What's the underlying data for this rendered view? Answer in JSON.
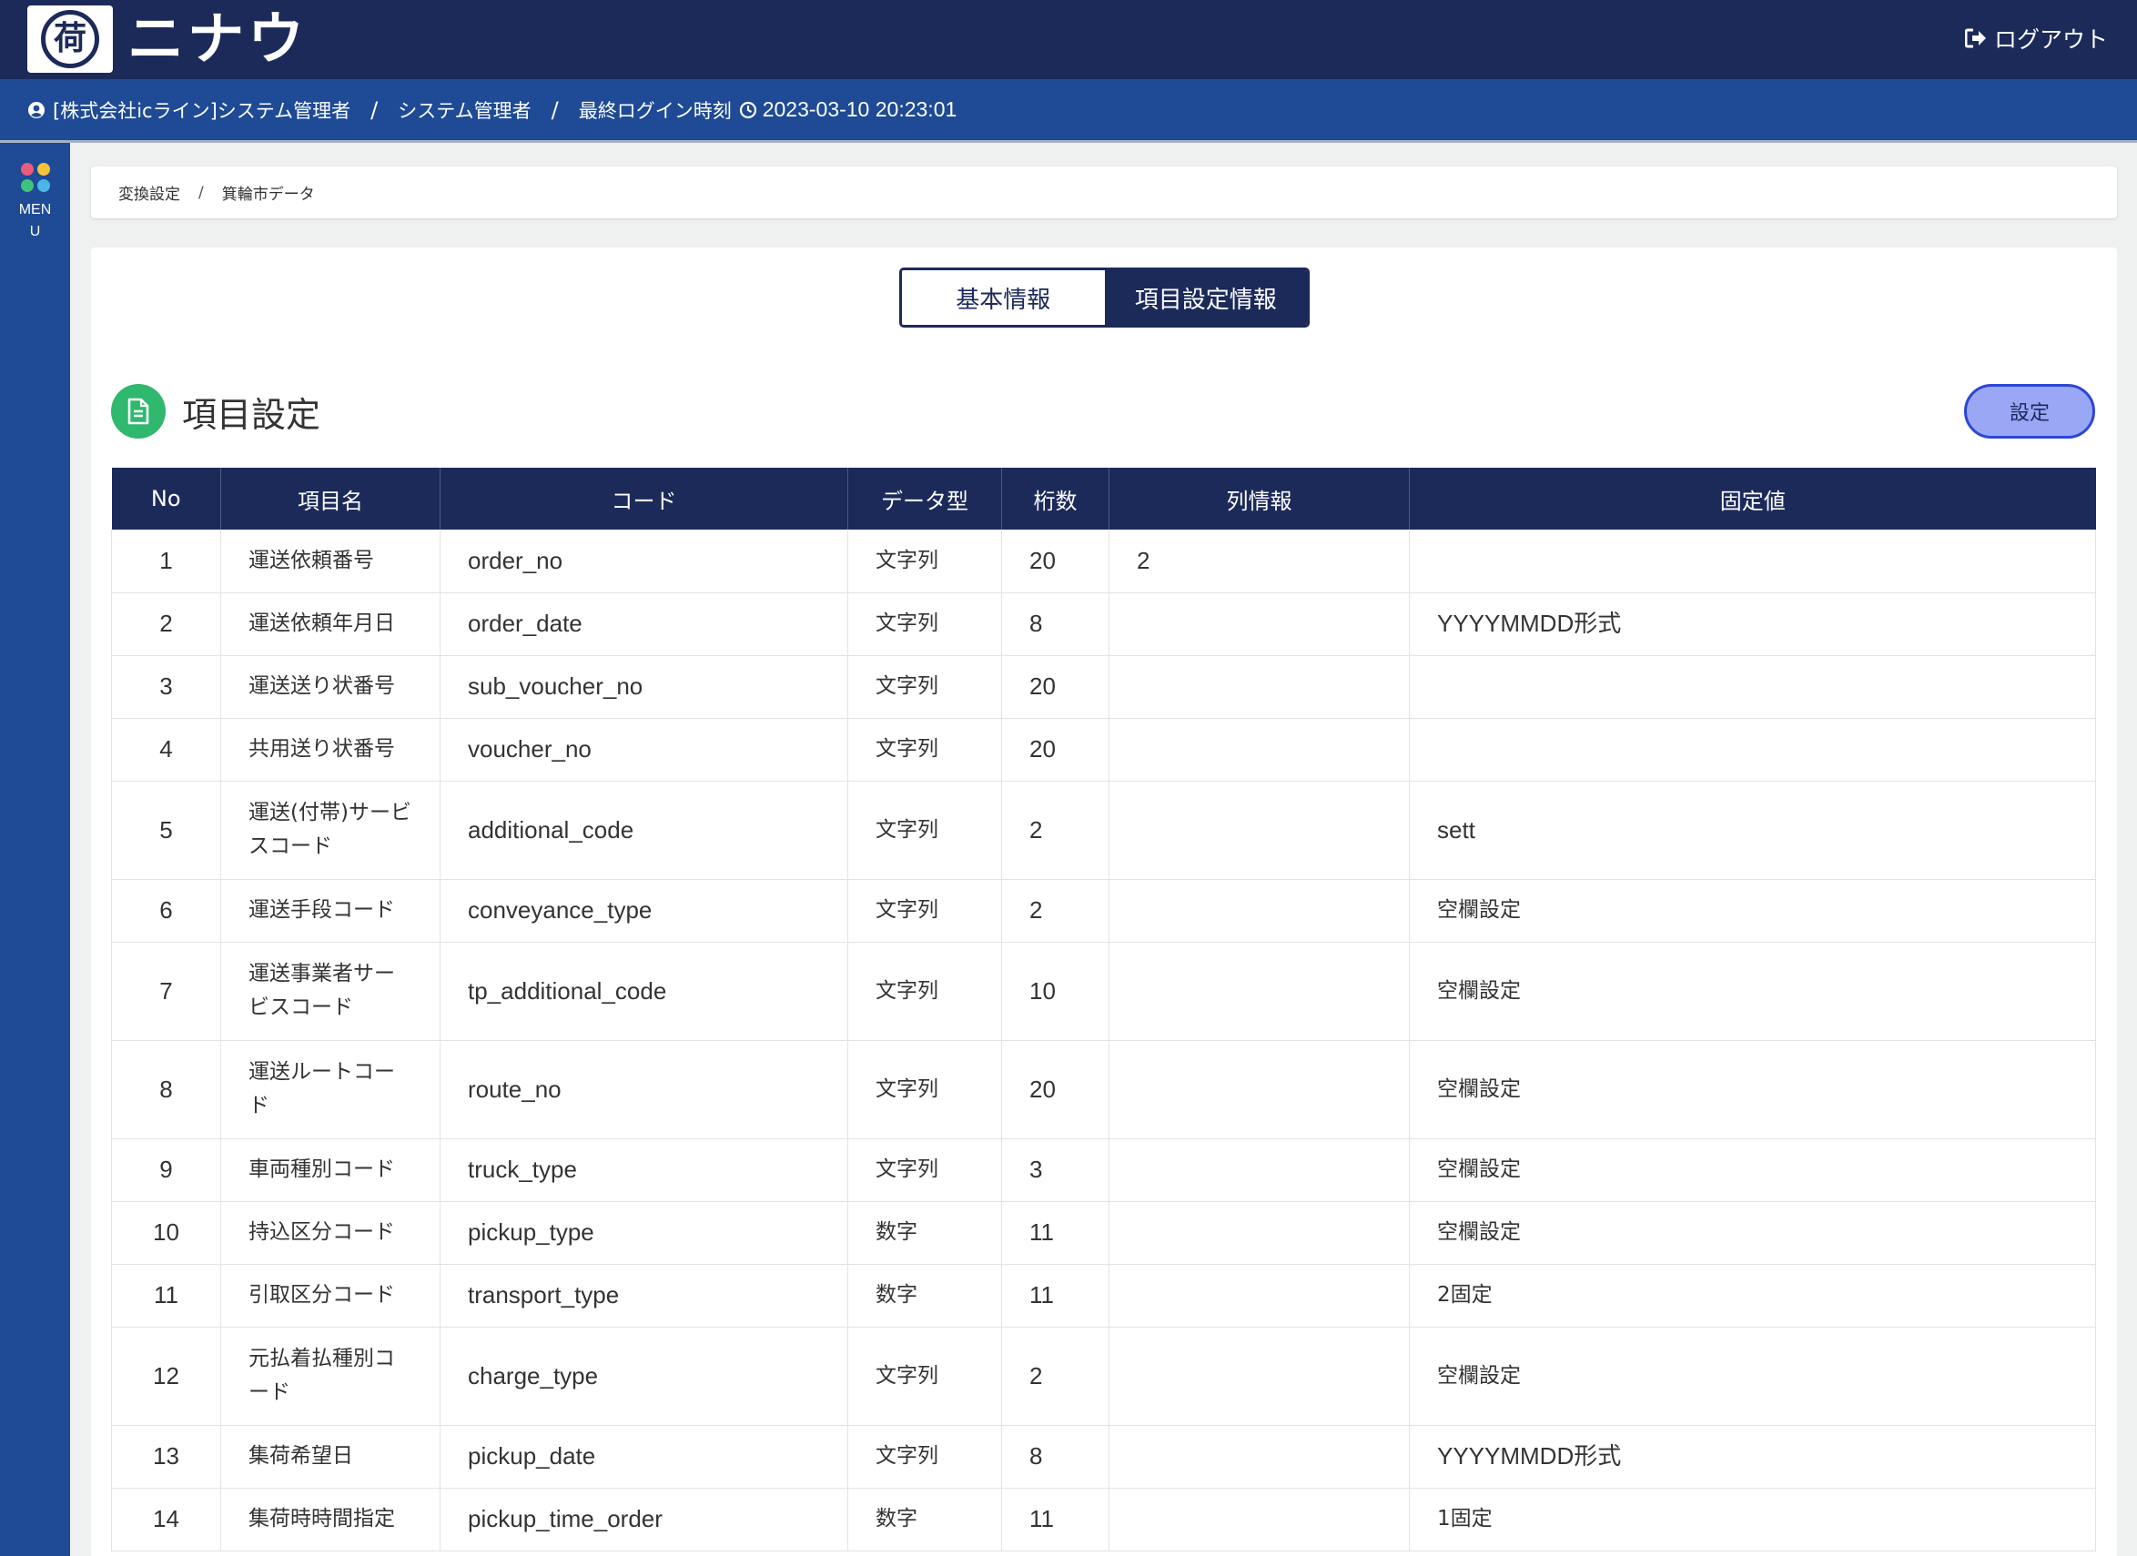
{
  "header": {
    "logo_mark": "荷",
    "logo_text": "ニナウ",
    "logout_label": "ログアウト"
  },
  "subbar": {
    "company": "[株式会社icライン]システム管理者",
    "separator": "/",
    "role": "システム管理者",
    "last_login_label": "最終ログイン時刻",
    "last_login_time": "2023-03-10 20:23:01"
  },
  "sidebar": {
    "menu_label": "MENU",
    "dot_colors": [
      "#e95c7c",
      "#f5c338",
      "#3fc27a",
      "#4ab6e8"
    ]
  },
  "breadcrumb": {
    "items": [
      "変換設定",
      "箕輪市データ"
    ],
    "separator": "/"
  },
  "tabs": [
    {
      "label": "基本情報",
      "active": false
    },
    {
      "label": "項目設定情報",
      "active": true
    }
  ],
  "section": {
    "title": "項目設定",
    "button_label": "設定"
  },
  "table": {
    "headers": [
      "No",
      "項目名",
      "コード",
      "データ型",
      "桁数",
      "列情報",
      "固定値"
    ],
    "rows": [
      {
        "no": "1",
        "name": "運送依頼番号",
        "code": "order_no",
        "type": "文字列",
        "digits": "20",
        "col": "2",
        "fixed": ""
      },
      {
        "no": "2",
        "name": "運送依頼年月日",
        "code": "order_date",
        "type": "文字列",
        "digits": "8",
        "col": "",
        "fixed": "YYYYMMDD形式"
      },
      {
        "no": "3",
        "name": "運送送り状番号",
        "code": "sub_voucher_no",
        "type": "文字列",
        "digits": "20",
        "col": "",
        "fixed": ""
      },
      {
        "no": "4",
        "name": "共用送り状番号",
        "code": "voucher_no",
        "type": "文字列",
        "digits": "20",
        "col": "",
        "fixed": ""
      },
      {
        "no": "5",
        "name": "運送(付帯)サービスコード",
        "code": "additional_code",
        "type": "文字列",
        "digits": "2",
        "col": "",
        "fixed": "sett"
      },
      {
        "no": "6",
        "name": "運送手段コード",
        "code": "conveyance_type",
        "type": "文字列",
        "digits": "2",
        "col": "",
        "fixed": "空欄設定"
      },
      {
        "no": "7",
        "name": "運送事業者サービスコード",
        "code": "tp_additional_code",
        "type": "文字列",
        "digits": "10",
        "col": "",
        "fixed": "空欄設定"
      },
      {
        "no": "8",
        "name": "運送ルートコード",
        "code": "route_no",
        "type": "文字列",
        "digits": "20",
        "col": "",
        "fixed": "空欄設定"
      },
      {
        "no": "9",
        "name": "車両種別コード",
        "code": "truck_type",
        "type": "文字列",
        "digits": "3",
        "col": "",
        "fixed": "空欄設定"
      },
      {
        "no": "10",
        "name": "持込区分コード",
        "code": "pickup_type",
        "type": "数字",
        "digits": "11",
        "col": "",
        "fixed": "空欄設定"
      },
      {
        "no": "11",
        "name": "引取区分コード",
        "code": "transport_type",
        "type": "数字",
        "digits": "11",
        "col": "",
        "fixed": "2固定"
      },
      {
        "no": "12",
        "name": "元払着払種別コード",
        "code": "charge_type",
        "type": "文字列",
        "digits": "2",
        "col": "",
        "fixed": "空欄設定"
      },
      {
        "no": "13",
        "name": "集荷希望日",
        "code": "pickup_date",
        "type": "文字列",
        "digits": "8",
        "col": "",
        "fixed": "YYYYMMDD形式"
      },
      {
        "no": "14",
        "name": "集荷時時間指定",
        "code": "pickup_time_order",
        "type": "数字",
        "digits": "11",
        "col": "",
        "fixed": "1固定"
      }
    ]
  }
}
